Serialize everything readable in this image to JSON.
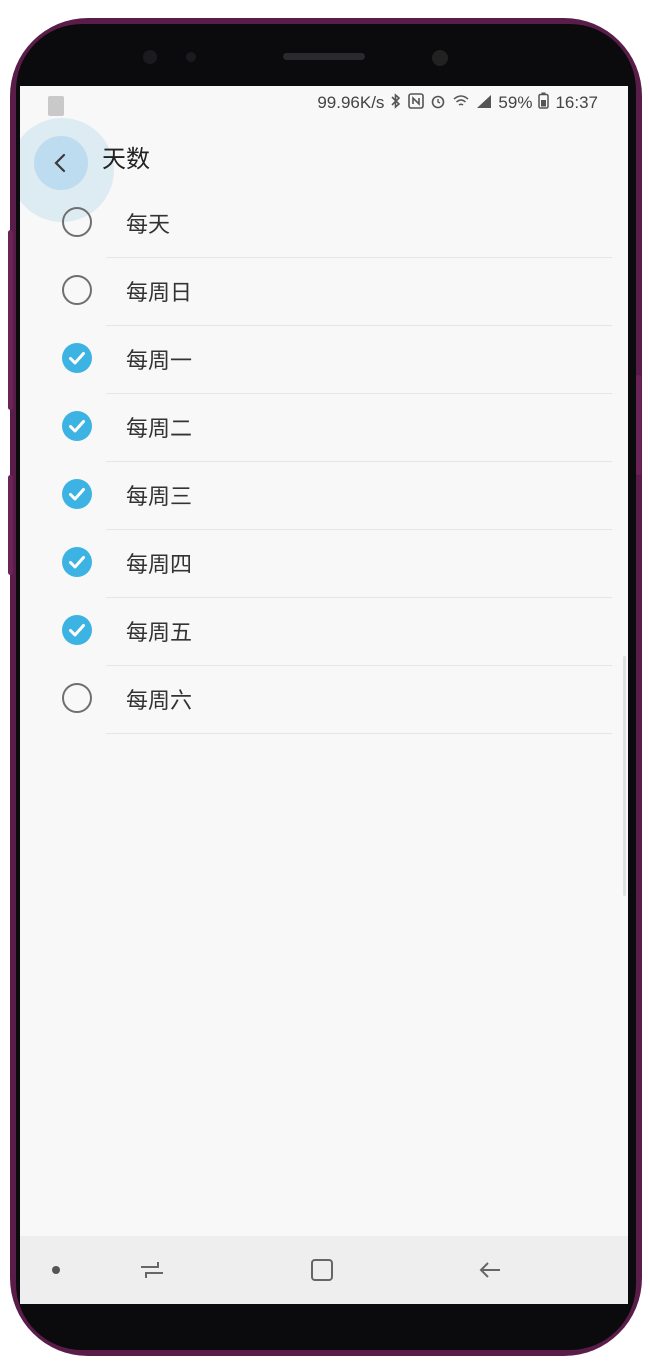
{
  "statusbar": {
    "speed": "99.96K/s",
    "battery": "59%",
    "time": "16:37",
    "icons": [
      "bluetooth-icon",
      "nfc-icon",
      "alarm-icon",
      "wifi-icon",
      "signal-icon",
      "battery-icon"
    ]
  },
  "appbar": {
    "title": "天数",
    "back_icon": "chevron-left-icon"
  },
  "days": [
    {
      "label": "每天",
      "checked": false
    },
    {
      "label": "每周日",
      "checked": false
    },
    {
      "label": "每周一",
      "checked": true
    },
    {
      "label": "每周二",
      "checked": true
    },
    {
      "label": "每周三",
      "checked": true
    },
    {
      "label": "每周四",
      "checked": true
    },
    {
      "label": "每周五",
      "checked": true
    },
    {
      "label": "每周六",
      "checked": false
    }
  ],
  "colors": {
    "accent": "#3db3e4",
    "phone_frame": "#5a1d4a",
    "screen_bg": "#f8f8f8"
  },
  "navbar": {
    "icons": [
      "recents-icon",
      "home-icon",
      "back-icon"
    ]
  }
}
